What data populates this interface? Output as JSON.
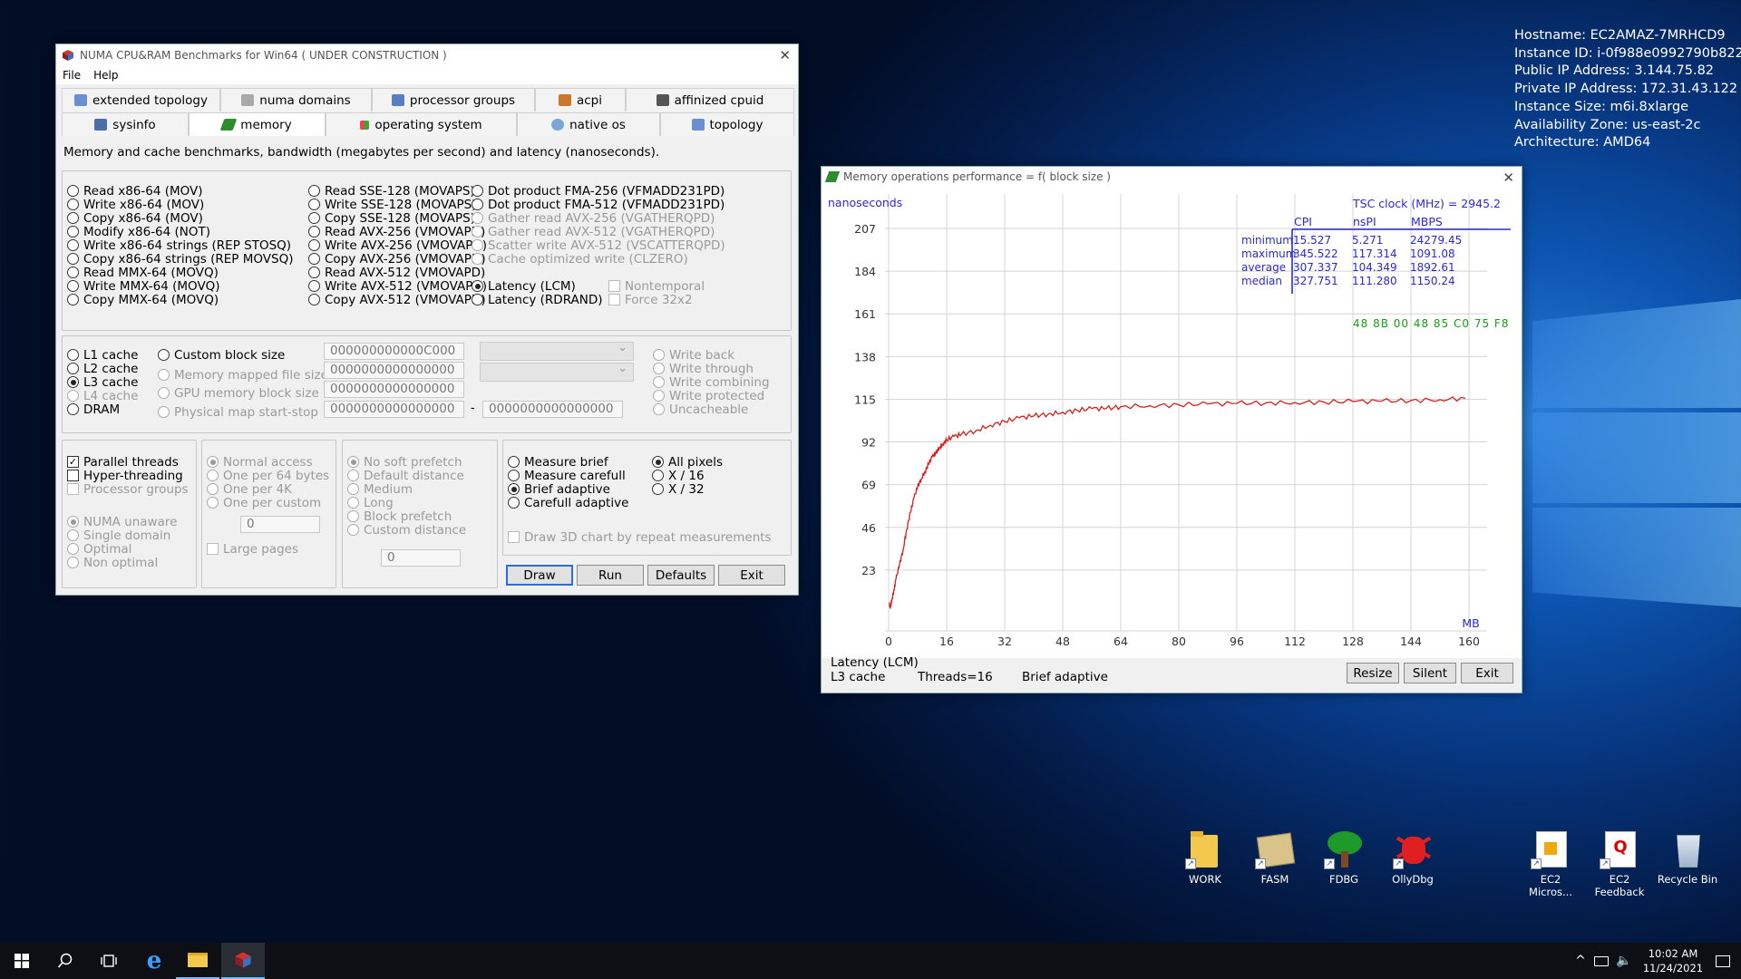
{
  "sysinfo": [
    "Hostname: EC2AMAZ-7MRHCD9",
    "Instance ID: i-0f988e0992790b822",
    "Public IP Address: 3.144.75.82",
    "Private IP Address: 172.31.43.122",
    "Instance Size: m6i.8xlarge",
    "Availability Zone: us-east-2c",
    "Architecture: AMD64"
  ],
  "main": {
    "title": "NUMA CPU&RAM Benchmarks for Win64 ( UNDER CONSTRUCTION )",
    "menu": [
      "File",
      "Help"
    ],
    "tabs_row1": [
      "extended topology",
      "numa domains",
      "processor groups",
      "acpi",
      "affinized cpuid"
    ],
    "tabs_row2": [
      "sysinfo",
      "memory",
      "operating system",
      "native os",
      "topology"
    ],
    "description": "Memory and cache benchmarks, bandwidth (megabytes per second) and latency (nanoseconds).",
    "ops_col1": [
      "Read x86-64 (MOV)",
      "Write x86-64 (MOV)",
      "Copy x86-64 (MOV)",
      "Modify x86-64 (NOT)",
      "Write x86-64 strings (REP STOSQ)",
      "Copy x86-64 strings (REP MOVSQ)",
      "Read MMX-64 (MOVQ)",
      "Write MMX-64 (MOVQ)",
      "Copy MMX-64 (MOVQ)"
    ],
    "ops_col2": [
      "Read SSE-128 (MOVAPS)",
      "Write SSE-128 (MOVAPS)",
      "Copy SSE-128 (MOVAPS)",
      "Read AVX-256 (VMOVAPD)",
      "Write AVX-256 (VMOVAPD)",
      "Copy AVX-256 (VMOVAPD)",
      "Read AVX-512 (VMOVAPD)",
      "Write AVX-512 (VMOVAPD)",
      "Copy AVX-512 (VMOVAPD)"
    ],
    "ops_col3": [
      "Dot product FMA-256 (VFMADD231PD)",
      "Dot product FMA-512 (VFMADD231PD)",
      "Gather read AVX-256 (VGATHERQPD)",
      "Gather read AVX-512 (VGATHERQPD)",
      "Scatter write AVX-512 (VSCATTERQPD)",
      "Cache optimized write (CLZERO)"
    ],
    "latency_opts": [
      "Latency (LCM)",
      "Latency (RDRAND)"
    ],
    "nontemporal": [
      "Nontemporal",
      "Force 32x2"
    ],
    "cache_levels": [
      "L1 cache",
      "L2 cache",
      "L3 cache",
      "L4 cache",
      "DRAM"
    ],
    "block_opts": [
      "Custom block size",
      "Memory mapped file size",
      "GPU memory block size",
      "Physical map start-stop"
    ],
    "block_values": [
      "000000000000C000",
      "0000000000000000",
      "0000000000000000",
      "0000000000000000",
      "0000000000000000"
    ],
    "range_dash": "-",
    "write_modes": [
      "Write back",
      "Write through",
      "Write combining",
      "Write protected",
      "Uncacheable"
    ],
    "threads": [
      "Parallel threads",
      "Hyper-threading",
      "Processor groups"
    ],
    "numa": [
      "NUMA unaware",
      "Single domain",
      "Optimal",
      "Non optimal"
    ],
    "access": [
      "Normal access",
      "One per 64 bytes",
      "One per 4K",
      "One per custom"
    ],
    "access_custom_value": "0",
    "large_pages": "Large pages",
    "prefetch": [
      "No soft prefetch",
      "Default distance",
      "Medium",
      "Long",
      "Block prefetch",
      "Custom distance"
    ],
    "prefetch_custom_value": "0",
    "measure": [
      "Measure brief",
      "Measure carefull",
      "Brief adaptive",
      "Carefull adaptive"
    ],
    "pixels": [
      "All pixels",
      "X / 16",
      "X / 32"
    ],
    "draw3d": "Draw 3D chart by repeat measurements",
    "buttons": [
      "Draw",
      "Run",
      "Defaults",
      "Exit"
    ]
  },
  "chart_win": {
    "title": "Memory operations performance = f( block size )",
    "status1": "Latency (LCM)",
    "status2": "L3 cache",
    "status3": "Threads=16",
    "status4": "Brief adaptive",
    "buttons": [
      "Resize",
      "Silent",
      "Exit"
    ]
  },
  "chart_data": {
    "type": "line",
    "ylabel": "nanoseconds",
    "xlabel": "MB",
    "xlim": [
      0,
      160
    ],
    "ylim": [
      0,
      207
    ],
    "xticks": [
      0,
      16,
      32,
      48,
      64,
      80,
      96,
      112,
      128,
      144,
      160
    ],
    "yticks": [
      23,
      46,
      69,
      92,
      115,
      138,
      161,
      184,
      207
    ],
    "tsc_label": "TSC clock (MHz) = 2945.2",
    "stats_columns": [
      "CPI",
      "nsPI",
      "MBPS"
    ],
    "stats_rows": [
      {
        "name": "minimum",
        "values": [
          "15.527",
          "5.271",
          "24279.45"
        ]
      },
      {
        "name": "maximum",
        "values": [
          "345.522",
          "117.314",
          "1091.08"
        ]
      },
      {
        "name": "average",
        "values": [
          "307.337",
          "104.349",
          "1892.61"
        ]
      },
      {
        "name": "median",
        "values": [
          "327.751",
          "111.280",
          "1150.24"
        ]
      }
    ],
    "opcode_bytes": "48 8B 00 48 85 C0 75 F8",
    "series": [
      {
        "color": "#d42020",
        "x": [
          0.2,
          0.5,
          1,
          1.5,
          2,
          3,
          4,
          5,
          6,
          7,
          8,
          9,
          10,
          11,
          12,
          13,
          14,
          15,
          16,
          18,
          20,
          24,
          28,
          32,
          36,
          40,
          44,
          48,
          52,
          56,
          60,
          64,
          72,
          80,
          88,
          96,
          104,
          112,
          120,
          128,
          136,
          144,
          152,
          159
        ],
        "y": [
          5,
          3,
          8,
          12,
          18,
          26,
          34,
          45,
          54,
          62,
          68,
          72,
          76,
          80,
          84,
          86,
          89,
          91,
          93,
          95,
          96,
          98,
          101,
          103,
          105,
          106,
          107,
          108,
          109,
          110,
          110,
          111,
          111.5,
          112,
          112.5,
          112.8,
          113,
          113.2,
          113.5,
          113.8,
          114,
          114.3,
          114.8,
          115.5
        ]
      }
    ]
  },
  "desktop_icons": [
    "WORK",
    "FASM",
    "FDBG",
    "OllyDbg",
    "EC2 Micros...",
    "EC2 Feedback",
    "Recycle Bin"
  ],
  "taskbar": {
    "time": "10:02 AM",
    "date": "11/24/2021"
  }
}
